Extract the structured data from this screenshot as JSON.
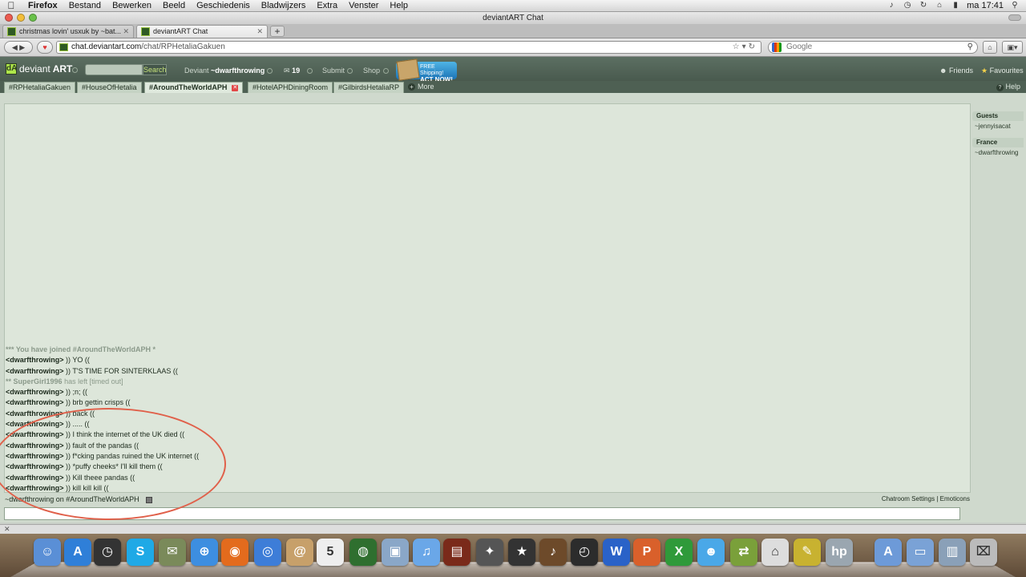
{
  "menubar": {
    "app": "Firefox",
    "items": [
      "Bestand",
      "Bewerken",
      "Beeld",
      "Geschiedenis",
      "Bladwijzers",
      "Extra",
      "Venster",
      "Help"
    ],
    "clock": "ma 17:41"
  },
  "window": {
    "title": "deviantART Chat"
  },
  "browser_tabs": [
    {
      "label": "christmas lovin' usxuk by ~bat...",
      "active": false
    },
    {
      "label": "deviantART Chat",
      "active": true
    }
  ],
  "nav": {
    "url_host": "chat.deviantart.com",
    "url_path": "/chat/RPHetaliaGakuen",
    "search_placeholder": "Google"
  },
  "da_header": {
    "logo_a": "deviant",
    "logo_b": "ART",
    "search_button": "Search",
    "deviant_label": "Deviant",
    "username": "~dwarfthrowing",
    "message_count": "19",
    "submit": "Submit",
    "shop": "Shop",
    "promo_line1": "FREE Shipping!",
    "promo_line2": "ACT NOW!",
    "friends": "Friends",
    "favourites": "Favourites",
    "help": "Help"
  },
  "channels": [
    {
      "label": "#RPHetaliaGakuen",
      "active": false
    },
    {
      "label": "#HouseOfHetalia",
      "active": false
    },
    {
      "label": "#AroundTheWorldAPH",
      "active": true
    },
    {
      "label": "#HotelAPHDiningRoom",
      "active": false
    },
    {
      "label": "#GilbirdsHetaliaRP",
      "active": false
    }
  ],
  "more_label": "More",
  "chat_log": [
    {
      "type": "sys",
      "text": "*** You have joined #AroundTheWorldAPH *"
    },
    {
      "type": "msg",
      "nick": "<dwarfthrowing>",
      "text": ")) YO (("
    },
    {
      "type": "msg",
      "nick": "<dwarfthrowing>",
      "text": ")) T'S TIME FOR SINTERKLAAS (("
    },
    {
      "type": "sys",
      "text": "** SuperGirl1996",
      "reason": "has left [timed out]"
    },
    {
      "type": "msg",
      "nick": "<dwarfthrowing>",
      "text": ")) ;n; (("
    },
    {
      "type": "msg",
      "nick": "<dwarfthrowing>",
      "text": ")) brb gettin crisps (("
    },
    {
      "type": "msg",
      "nick": "<dwarfthrowing>",
      "text": ")) back (("
    },
    {
      "type": "msg",
      "nick": "<dwarfthrowing>",
      "text": ")) ..... (("
    },
    {
      "type": "msg",
      "nick": "<dwarfthrowing>",
      "text": ")) I think the internet of the UK died (("
    },
    {
      "type": "msg",
      "nick": "<dwarfthrowing>",
      "text": ")) fault of the pandas (("
    },
    {
      "type": "msg",
      "nick": "<dwarfthrowing>",
      "text": ")) f*cking pandas ruined the UK internet (("
    },
    {
      "type": "msg",
      "nick": "<dwarfthrowing>",
      "text": ")) *puffy cheeks* I'll kill them (("
    },
    {
      "type": "msg",
      "nick": "<dwarfthrowing>",
      "text": ")) Kill theee pandas (("
    },
    {
      "type": "msg",
      "nick": "<dwarfthrowing>",
      "text": ")) kill kill kill (("
    }
  ],
  "userlist": [
    {
      "group": "Guests",
      "users": [
        "~jennyisacat"
      ]
    },
    {
      "group": "France",
      "users": [
        "~dwarfthrowing"
      ]
    }
  ],
  "status_line": "~dwarfthrowing on #AroundTheWorldAPH",
  "bottom_links": {
    "settings": "Chatroom Settings",
    "sep": "|",
    "emoticons": "Emoticons"
  },
  "dock_apps": [
    "Finder",
    "App Store",
    "Dashboard",
    "Skype",
    "Mail Stamp",
    "Safari",
    "Firefox",
    "iChat",
    "Address Book",
    "iCal",
    "Google Earth",
    "iPhoto",
    "iTunes",
    "Photo Booth",
    "iMovie",
    "iMovie Star",
    "GarageBand",
    "Time Machine",
    "Word",
    "PowerPoint",
    "Excel",
    "Messenger",
    "Migration",
    "Network",
    "Paint",
    "HP",
    "Applications",
    "Documents",
    "Downloads",
    "Trash"
  ]
}
